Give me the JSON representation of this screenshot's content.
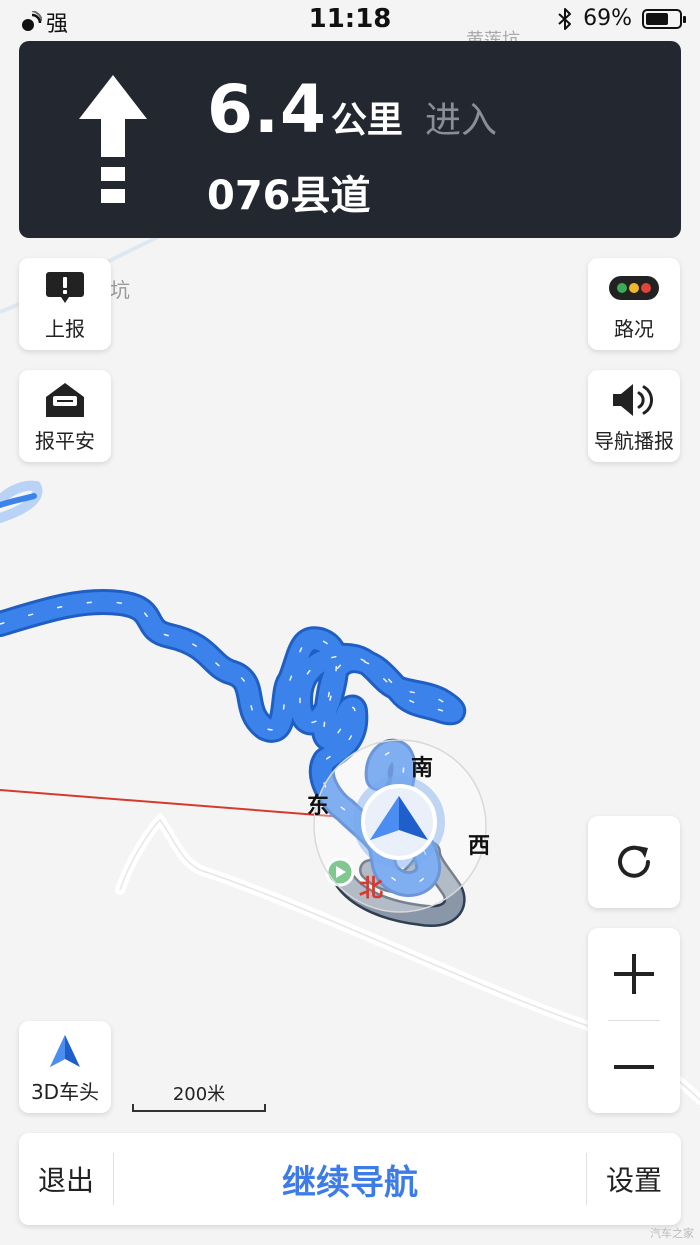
{
  "status_bar": {
    "signal_text": "强",
    "time": "11:18",
    "battery_text": "69%",
    "battery_level": 0.69,
    "icons": [
      "signal-icon",
      "bluetooth-icon",
      "battery-icon"
    ]
  },
  "guidance": {
    "maneuver_icon": "straight-arrow-icon",
    "distance": "6.4",
    "unit": "公里",
    "action": "进入",
    "road": "076县道"
  },
  "map": {
    "labels": [
      "黄莲坑",
      "坑"
    ],
    "colors": {
      "route_active": "#3b83ea",
      "route_passed": "#8a97a8",
      "background": "#f4f4f4",
      "guide_line": "#d63a2f",
      "start_point": "#3cab55"
    }
  },
  "compass": {
    "north": "北",
    "south": "南",
    "east": "东",
    "west": "西"
  },
  "left_buttons": [
    {
      "label": "上报",
      "icon": "report-icon"
    },
    {
      "label": "报平安",
      "icon": "safety-message-icon"
    }
  ],
  "right_buttons": [
    {
      "label": "路况",
      "icon": "traffic-light-icon"
    },
    {
      "label": "导航播报",
      "icon": "speaker-icon"
    }
  ],
  "refresh_icon": "refresh-icon",
  "zoom": {
    "in_icon": "zoom-in-icon",
    "out_icon": "zoom-out-icon"
  },
  "view_mode": {
    "label": "3D车头",
    "icon": "heading-up-arrow-icon"
  },
  "scale": {
    "label": "200米"
  },
  "bottom_bar": {
    "exit": "退出",
    "resume": "继续导航",
    "settings": "设置"
  },
  "watermark": "汽车之家"
}
